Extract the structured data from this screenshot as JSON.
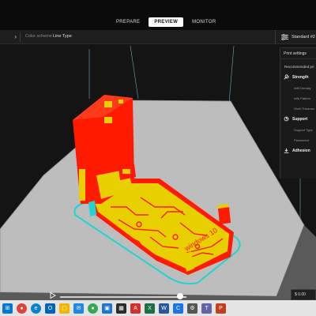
{
  "header": {
    "stages": [
      {
        "label": "PREPARE",
        "active": false
      },
      {
        "label": "PREVIEW",
        "active": true
      },
      {
        "label": "MONITOR",
        "active": false
      }
    ]
  },
  "toolbar": {
    "color_scheme_label": "Color scheme",
    "color_scheme_value": "Line Type",
    "profile_label": "Standard #2"
  },
  "print_settings": {
    "title": "Print settings",
    "recommended_label": "Recommended pri",
    "sections": [
      {
        "label": "Strength",
        "icon": "wrench-icon",
        "rows": [
          "Infill Density",
          "Infill Pattern",
          "Shell Thicknes"
        ]
      },
      {
        "label": "Support",
        "icon": "support-icon",
        "rows": [
          "Support Type",
          "Placement"
        ]
      },
      {
        "label": "Adhesion",
        "icon": "adhesion-icon",
        "rows": []
      }
    ]
  },
  "playback": {
    "cost_label": "$ 0.00",
    "progress": 0.95
  },
  "colors": {
    "wall": "#ff1a00",
    "infill": "#e8d000",
    "skirt": "#22d3d3",
    "bed": "#bdbdbd",
    "accent": "#ffffff"
  },
  "taskbar": {
    "icons": [
      "windows-icon",
      "chrome-icon",
      "edge-icon",
      "outlook-icon",
      "file-explorer-icon",
      "mail-icon",
      "chrome-icon",
      "photos-icon",
      "store-icon",
      "acrobat-icon",
      "excel-icon",
      "word-icon",
      "cura-icon",
      "settings-icon",
      "teams-icon",
      "powerpoint-icon"
    ]
  }
}
